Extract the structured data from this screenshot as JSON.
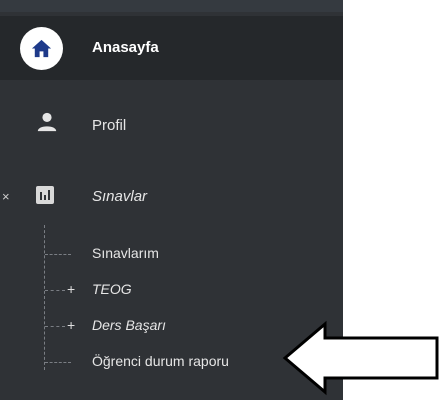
{
  "menu": {
    "home": {
      "label": "Anasayfa",
      "icon": "home-icon"
    },
    "profile": {
      "label": "Profil",
      "icon": "person-icon"
    },
    "exams": {
      "label": "Sınavlar",
      "icon": "bar-chart-icon",
      "collapse_icon": "close-icon",
      "collapse_glyph": "×",
      "children": [
        {
          "label": "Sınavlarım",
          "expandable": false
        },
        {
          "label": "TEOG",
          "expandable": true,
          "expand_glyph": "+"
        },
        {
          "label": "Ders Başarı",
          "expandable": true,
          "expand_glyph": "+"
        },
        {
          "label": "Öğrenci durum raporu",
          "expandable": false
        }
      ]
    }
  },
  "annotation": {
    "icon": "left-arrow-icon"
  },
  "colors": {
    "sidebar_bg": "#2f3236",
    "active_bg": "#25282b",
    "accent": "#1e3a8a",
    "text": "#e6e6e6"
  }
}
